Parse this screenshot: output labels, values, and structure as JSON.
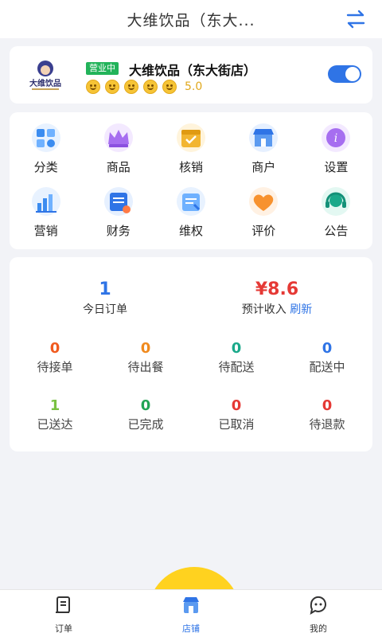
{
  "header": {
    "title": "大维饮品（东大...",
    "switch_icon": "swap-icon"
  },
  "store": {
    "logo_text": "大维饮品",
    "status_badge": "营业中",
    "name": "大维饮品（东大街店）",
    "rating": "5.0",
    "rating_icon": "smiley-face-icon",
    "open_toggle": true
  },
  "menu": {
    "items": [
      {
        "label": "分类",
        "icon": "category-icon"
      },
      {
        "label": "商品",
        "icon": "crown-icon"
      },
      {
        "label": "核销",
        "icon": "calendar-check-icon"
      },
      {
        "label": "商户",
        "icon": "shop-icon"
      },
      {
        "label": "设置",
        "icon": "info-settings-icon"
      },
      {
        "label": "营销",
        "icon": "bar-chart-icon"
      },
      {
        "label": "财务",
        "icon": "finance-icon"
      },
      {
        "label": "维权",
        "icon": "rights-doc-icon"
      },
      {
        "label": "评价",
        "icon": "heart-icon"
      },
      {
        "label": "公告",
        "icon": "headset-icon"
      }
    ]
  },
  "stats": {
    "today_orders": {
      "value": "1",
      "label": "今日订单"
    },
    "expected_income": {
      "value": "¥8.6",
      "label": "预计收入",
      "refresh": "刷新"
    },
    "row1": [
      {
        "value": "0",
        "label": "待接单",
        "color": "#f05a1e"
      },
      {
        "value": "0",
        "label": "待出餐",
        "color": "#f08a1e"
      },
      {
        "value": "0",
        "label": "待配送",
        "color": "#1aa98a"
      },
      {
        "value": "0",
        "label": "配送中",
        "color": "#2f74e6"
      }
    ],
    "row2": [
      {
        "value": "1",
        "label": "已送达",
        "color": "#79c142"
      },
      {
        "value": "0",
        "label": "已完成",
        "color": "#22a455"
      },
      {
        "value": "0",
        "label": "已取消",
        "color": "#e53935"
      },
      {
        "value": "0",
        "label": "待退款",
        "color": "#e53935"
      }
    ]
  },
  "nav": {
    "items": [
      {
        "label": "订单",
        "icon": "order-icon"
      },
      {
        "label": "店铺",
        "icon": "store-icon",
        "active": true
      },
      {
        "label": "我的",
        "icon": "chat-profile-icon"
      }
    ]
  },
  "colors": {
    "accent": "#2f74e6",
    "income": "#e53935",
    "badge": "#22b35a"
  }
}
